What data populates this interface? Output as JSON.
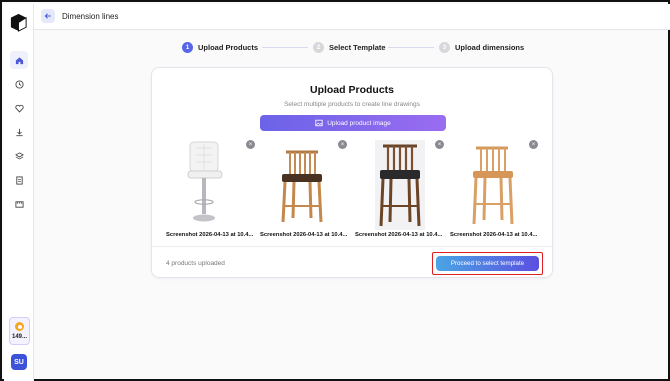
{
  "header": {
    "title": "Dimension lines"
  },
  "stepper": {
    "steps": [
      {
        "num": "1",
        "label": "Upload Products"
      },
      {
        "num": "2",
        "label": "Select Template"
      },
      {
        "num": "3",
        "label": "Upload dimensions"
      }
    ]
  },
  "card": {
    "title": "Upload Products",
    "subtitle": "Select multiple products to create line drawings",
    "upload_label": "Upload product image",
    "uploaded_count": "4 products uploaded",
    "proceed_label": "Proceed to select template"
  },
  "products": [
    {
      "caption": "Screenshot 2026-04-13 at 10.4...",
      "icon": "white-bar-stool-image"
    },
    {
      "caption": "Screenshot 2026-04-13 at 10.4...",
      "icon": "wood-bar-stool-image"
    },
    {
      "caption": "Screenshot 2026-04-13 at 10.4...",
      "icon": "dark-seat-bar-stool-image"
    },
    {
      "caption": "Screenshot 2026-04-13 at 10.4...",
      "icon": "light-wood-bar-stool-image"
    }
  ],
  "sidebar": {
    "credits": "149...",
    "avatar": "SU",
    "icons": [
      "home-icon",
      "history-icon",
      "heart-icon",
      "download-icon",
      "layers-icon",
      "document-icon",
      "ruler-icon"
    ]
  },
  "colors": {
    "accent": "#5865e8",
    "highlight": "#e02020"
  }
}
